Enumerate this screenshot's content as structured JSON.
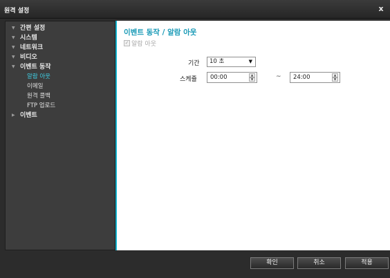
{
  "window": {
    "title": "원격 설정",
    "close_glyph": "x"
  },
  "sidebar": {
    "items": [
      {
        "label": "간편 설정",
        "level": "top",
        "caret": "▼",
        "icon": "caret-down-icon"
      },
      {
        "label": "시스템",
        "level": "top",
        "caret": "▼",
        "icon": "caret-down-icon"
      },
      {
        "label": "네트워크",
        "level": "top",
        "caret": "▼",
        "icon": "caret-down-icon"
      },
      {
        "label": "비디오",
        "level": "top",
        "caret": "▼",
        "icon": "caret-down-icon"
      },
      {
        "label": "이벤트 동작",
        "level": "top",
        "caret": "▼",
        "icon": "caret-down-icon"
      },
      {
        "label": "알람 아웃",
        "level": "sub",
        "active": true
      },
      {
        "label": "이메일",
        "level": "sub"
      },
      {
        "label": "원격 콜백",
        "level": "sub"
      },
      {
        "label": "FTP 업로드",
        "level": "sub"
      },
      {
        "label": "이벤트",
        "level": "top",
        "caret": "▶",
        "icon": "caret-right-icon"
      }
    ]
  },
  "main": {
    "title": "이벤트 동작 / 알람 아웃",
    "enable_checkbox": {
      "label": "알람 아웃",
      "checked": true,
      "disabled": true,
      "mark": "✓"
    },
    "duration": {
      "label": "기간",
      "value": "10 초",
      "arrow": "▼"
    },
    "schedule": {
      "label": "스케쥴",
      "start": "00:00",
      "end": "24:00",
      "separator": "~",
      "up_glyph": "▲",
      "down_glyph": "▼"
    }
  },
  "footer": {
    "ok_label": "확인",
    "cancel_label": "취소",
    "apply_label": "적용"
  },
  "colors": {
    "accent": "#1799b6",
    "active_item": "#3ed0e6",
    "sidebar_bg": "#3d3d3d",
    "window_bg": "#2c2c2c",
    "content_border": "#14b4cf"
  }
}
